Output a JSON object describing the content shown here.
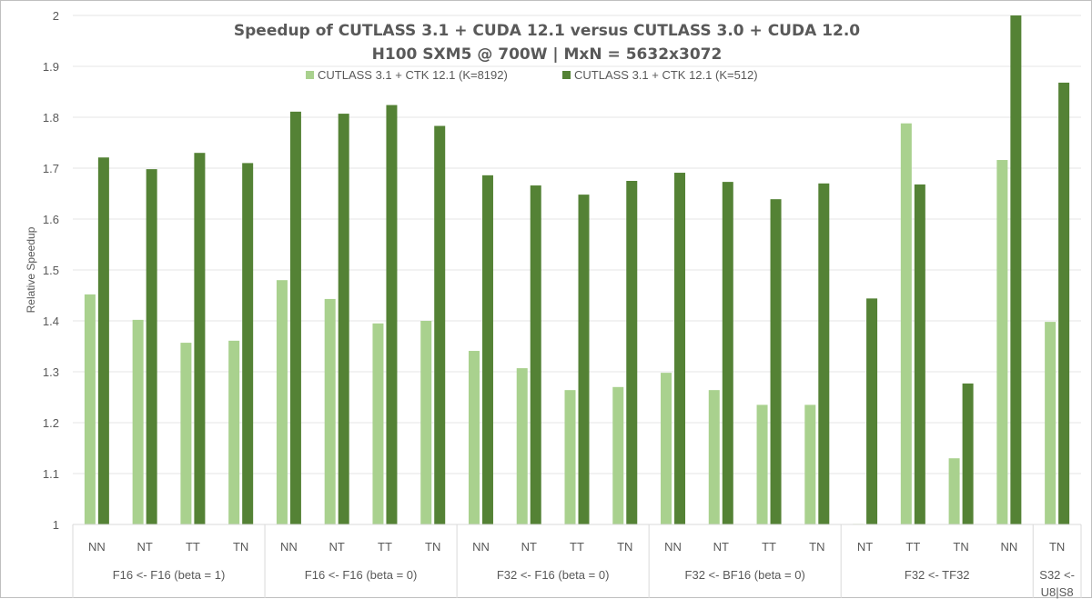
{
  "chart_data": {
    "type": "bar",
    "title": "Speedup of CUTLASS 3.1 + CUDA 12.1 versus CUTLASS 3.0 + CUDA 12.0",
    "subtitle": "H100 SXM5 @ 700W | MxN = 5632x3072",
    "xlabel": "",
    "ylabel": "Relative Speedup",
    "ylim": [
      1,
      2
    ],
    "yticks": [
      "1",
      "1.1",
      "1.2",
      "1.3",
      "1.4",
      "1.5",
      "1.6",
      "1.7",
      "1.8",
      "1.9",
      "2"
    ],
    "grid": true,
    "legend_position": "top-center",
    "groups": [
      {
        "label": "F16 <- F16 (beta = 1)",
        "categories": [
          "NN",
          "NT",
          "TT",
          "TN"
        ]
      },
      {
        "label": "F16 <- F16 (beta = 0)",
        "categories": [
          "NN",
          "NT",
          "TT",
          "TN"
        ]
      },
      {
        "label": "F32 <- F16 (beta = 0)",
        "categories": [
          "NN",
          "NT",
          "TT",
          "TN"
        ]
      },
      {
        "label": "F32 <- BF16 (beta = 0)",
        "categories": [
          "NN",
          "NT",
          "TT",
          "TN"
        ]
      },
      {
        "label": "F32 <- TF32",
        "categories": [
          "NT",
          "TT",
          "TN",
          "NN"
        ]
      },
      {
        "label": "S32 <- U8|S8",
        "label_lines": [
          "S32 <-",
          "U8|S8"
        ],
        "categories": [
          "TN"
        ]
      }
    ],
    "series": [
      {
        "name": "CUTLASS 3.1 + CTK 12.1 (K=8192)",
        "color": "#a9d18e",
        "values": [
          1.452,
          1.402,
          1.357,
          1.361,
          1.48,
          1.443,
          1.395,
          1.4,
          1.341,
          1.307,
          1.264,
          1.27,
          1.298,
          1.264,
          1.235,
          1.235,
          1.001,
          1.788,
          1.13,
          1.716,
          1.398
        ]
      },
      {
        "name": "CUTLASS 3.1 + CTK 12.1 (K=512)",
        "color": "#548235",
        "values": [
          1.721,
          1.698,
          1.73,
          1.71,
          1.811,
          1.807,
          1.824,
          1.783,
          1.686,
          1.666,
          1.648,
          1.675,
          1.691,
          1.673,
          1.639,
          1.67,
          1.444,
          1.668,
          1.277,
          2.0,
          1.868
        ]
      }
    ]
  }
}
